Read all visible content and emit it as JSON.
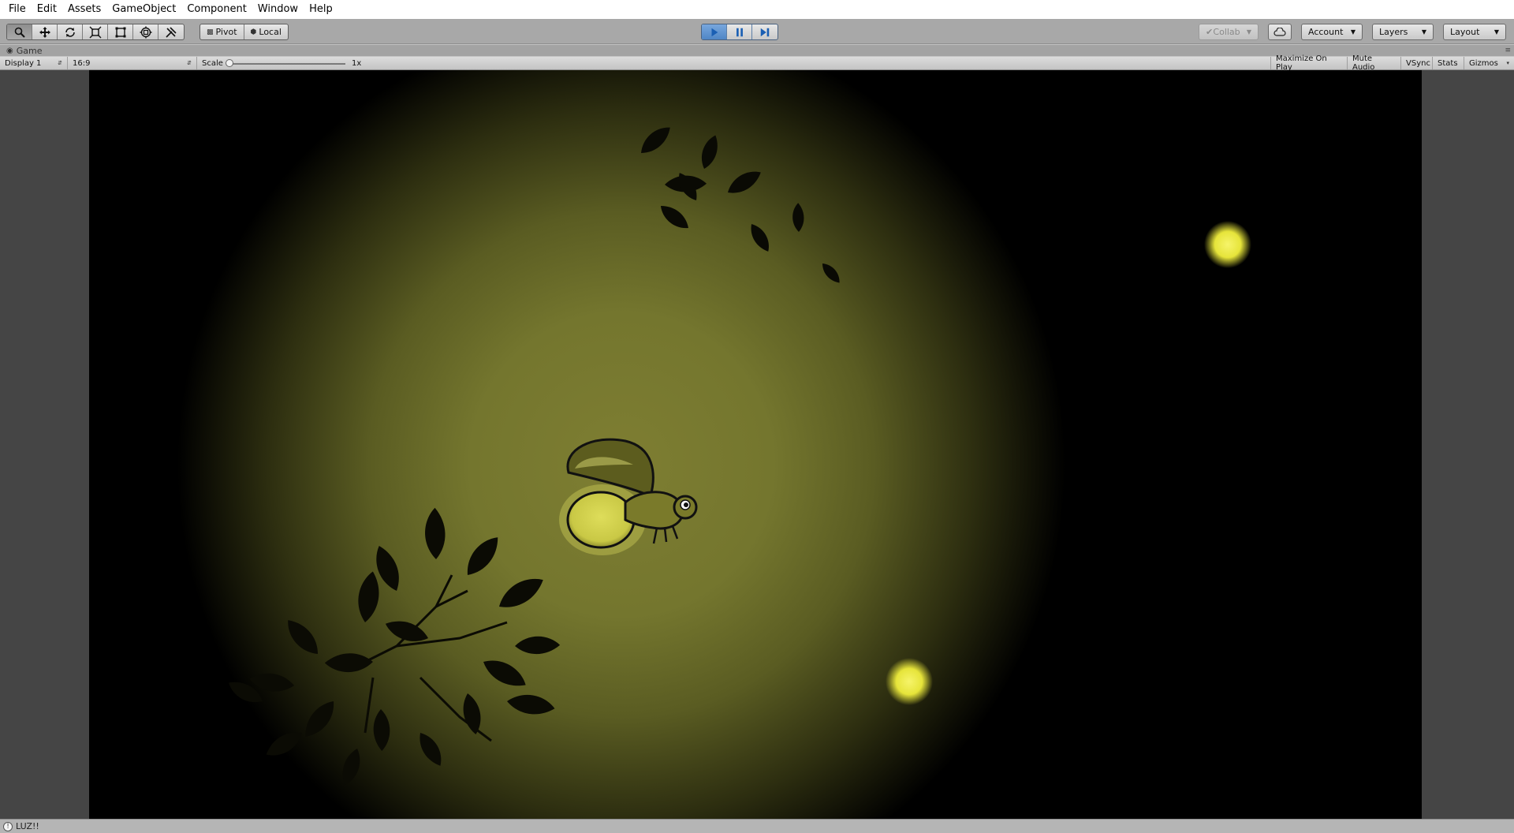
{
  "menu": [
    "File",
    "Edit",
    "Assets",
    "GameObject",
    "Component",
    "Window",
    "Help"
  ],
  "toolbar": {
    "tools": [
      "hand-icon",
      "move-icon",
      "rotate-icon",
      "scale-icon",
      "rect-icon",
      "transform-icon",
      "custom-tool-icon"
    ],
    "pivot_label": "Pivot",
    "local_label": "Local",
    "collab_label": "Collab",
    "account_label": "Account",
    "layers_label": "Layers",
    "layout_label": "Layout"
  },
  "tab": {
    "title": "Game"
  },
  "game_toolbar": {
    "display": "Display 1",
    "aspect": "16:9",
    "scale_label": "Scale",
    "scale_value": "1x",
    "maximize": "Maximize On Play",
    "mute": "Mute Audio",
    "vsync": "VSync",
    "stats": "Stats",
    "gizmos": "Gizmos"
  },
  "status": {
    "message": "LUZ!!"
  },
  "colors": {
    "play_active": "#4f86c6",
    "glow": "#7e7e32",
    "firefly_light": "#f0f04a"
  }
}
